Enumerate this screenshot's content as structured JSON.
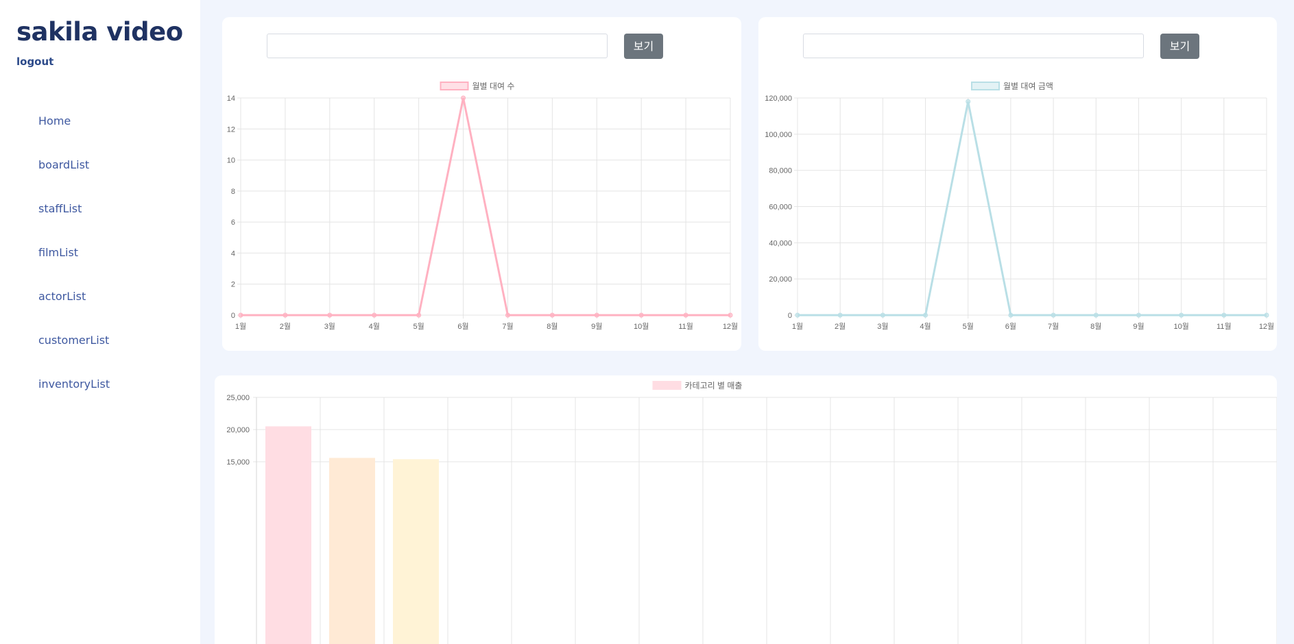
{
  "sidebar": {
    "brand": "sakila video",
    "logout": "logout",
    "items": [
      {
        "label": "Home"
      },
      {
        "label": "boardList"
      },
      {
        "label": "staffList"
      },
      {
        "label": "filmList"
      },
      {
        "label": "actorList"
      },
      {
        "label": "customerList"
      },
      {
        "label": "inventoryList"
      }
    ]
  },
  "left_panel": {
    "search": {
      "value": "",
      "placeholder": ""
    },
    "button_label": "보기"
  },
  "right_panel": {
    "search": {
      "value": "",
      "placeholder": ""
    },
    "button_label": "보기"
  },
  "colors": {
    "rental_count_line": "#ffb1c1",
    "rental_amount_line": "#b9dfe6",
    "bar_1": "#ffdde3",
    "bar_2": "#ffead5",
    "bar_3": "#fff3d6"
  },
  "chart_data": [
    {
      "type": "line",
      "title": "",
      "legend": "월별 대여 수",
      "categories": [
        "1월",
        "2월",
        "3월",
        "4월",
        "5월",
        "6월",
        "7월",
        "8월",
        "9월",
        "10월",
        "11월",
        "12월"
      ],
      "values": [
        0,
        0,
        0,
        0,
        0,
        14,
        0,
        0,
        0,
        0,
        0,
        0
      ],
      "y_ticks": [
        "0",
        "2",
        "4",
        "6",
        "8",
        "10",
        "12",
        "14"
      ],
      "ylim": [
        0,
        14
      ],
      "grid": true,
      "legend_position": "top"
    },
    {
      "type": "line",
      "title": "",
      "legend": "월별 대여 금액",
      "categories": [
        "1월",
        "2월",
        "3월",
        "4월",
        "5월",
        "6월",
        "7월",
        "8월",
        "9월",
        "10월",
        "11월",
        "12월"
      ],
      "values": [
        0,
        0,
        0,
        0,
        118000,
        0,
        0,
        0,
        0,
        0,
        0,
        0
      ],
      "y_ticks": [
        "0",
        "20,000",
        "40,000",
        "60,000",
        "80,000",
        "100,000",
        "120,000"
      ],
      "ylim": [
        0,
        120000
      ],
      "grid": true,
      "legend_position": "top"
    },
    {
      "type": "bar",
      "title": "",
      "legend": "카테고리 별 매출",
      "values": [
        20500,
        15600,
        15400
      ],
      "y_ticks_visible": [
        "25,000",
        "20,000",
        "15,000"
      ],
      "ylim_visible": [
        12000,
        25000
      ],
      "grid": true,
      "legend_position": "top"
    }
  ]
}
